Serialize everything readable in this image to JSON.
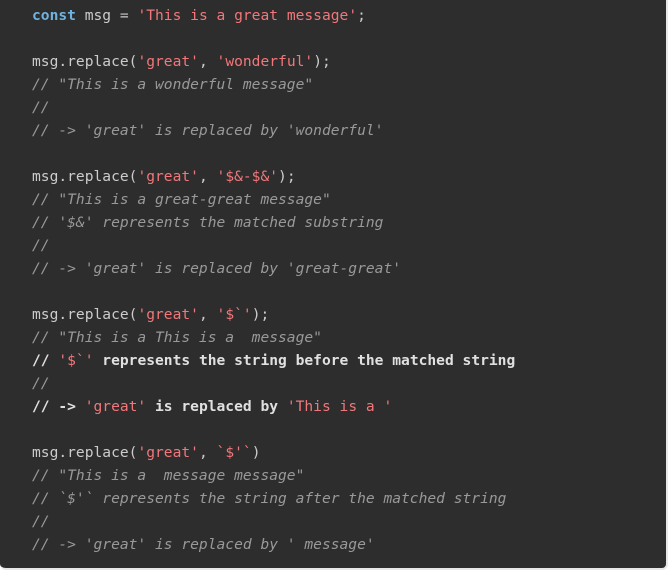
{
  "colors": {
    "background": "#2d2d2d",
    "keyword": "#6fb3e0",
    "string": "#f2777a",
    "comment": "#999999",
    "text": "#cccccc"
  },
  "code": {
    "l1": {
      "kw": "const",
      "a": " msg = ",
      "s1": "'This is a great message'",
      "b": ";"
    },
    "l3": {
      "a": "msg.replace(",
      "s1": "'great'",
      "b": ", ",
      "s2": "'wonderful'",
      "c": ");"
    },
    "l4": "// \"This is a wonderful message\"",
    "l5": "//",
    "l6": "// -> 'great' is replaced by 'wonderful'",
    "l8": {
      "a": "msg.replace(",
      "s1": "'great'",
      "b": ", ",
      "s2": "'$&-$&'",
      "c": ");"
    },
    "l9": "// \"This is a great-great message\"",
    "l10": "// '$&' represents the matched substring",
    "l11": "//",
    "l12": "// -> 'great' is replaced by 'great-great'",
    "l14": {
      "a": "msg.replace(",
      "s1": "'great'",
      "b": ", ",
      "s2": "'$`'",
      "c": ");"
    },
    "l15": "// \"This is a This is a  message\"",
    "l16": {
      "a": "// ",
      "s1": "'$`'",
      "b": " represents the string before the matched string"
    },
    "l17": "//",
    "l18": {
      "a": "// -> ",
      "s1": "'great'",
      "b": " is replaced by ",
      "s2": "'This is a '"
    },
    "l20": {
      "a": "msg.replace(",
      "s1": "'great'",
      "b": ", ",
      "s2": "`$'`",
      "c": ")"
    },
    "l21": "// \"This is a  message message\"",
    "l22": "// `$'` represents the string after the matched string",
    "l23": "//",
    "l24": "// -> 'great' is replaced by ' message'"
  }
}
